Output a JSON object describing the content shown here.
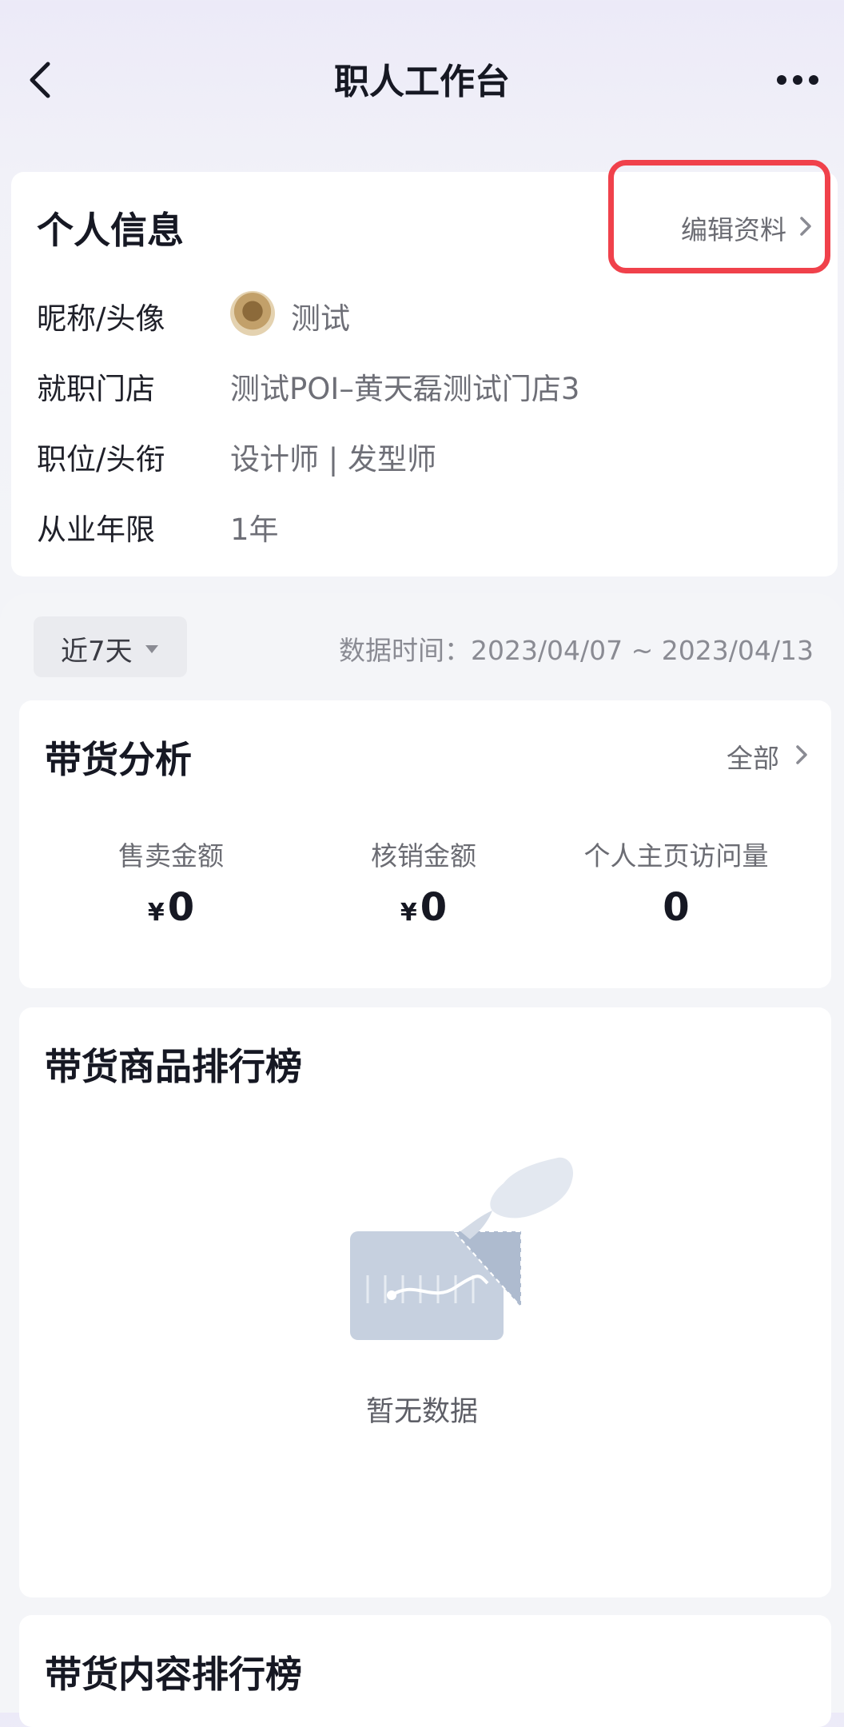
{
  "header": {
    "title": "职人工作台",
    "back_icon": "chevron-left-icon",
    "more_icon": "more-horizontal-icon"
  },
  "personal_info": {
    "title": "个人信息",
    "edit_label": "编辑资料",
    "rows": [
      {
        "label": "昵称/头像",
        "value": "测试"
      },
      {
        "label": "就职门店",
        "value": "测试POI–黄天磊测试门店3"
      },
      {
        "label": "职位/头衔",
        "value": "设计师 | 发型师"
      },
      {
        "label": "从业年限",
        "value": "1年"
      }
    ]
  },
  "filter": {
    "period": "近7天",
    "date_range": "数据时间：2023/04/07 ~ 2023/04/13"
  },
  "analysis": {
    "title": "带货分析",
    "all_label": "全部",
    "metrics": [
      {
        "label": "售卖金额",
        "currency": "¥",
        "value": "0"
      },
      {
        "label": "核销金额",
        "currency": "¥",
        "value": "0"
      },
      {
        "label": "个人主页访问量",
        "currency": "",
        "value": "0"
      }
    ]
  },
  "ranking": {
    "title": "带货商品排行榜",
    "empty_text": "暂无数据"
  },
  "content_ranking": {
    "title": "带货内容排行榜"
  },
  "colors": {
    "highlight": "#F0414B",
    "card": "#FFFFFF",
    "background": "#F3F4F8"
  }
}
